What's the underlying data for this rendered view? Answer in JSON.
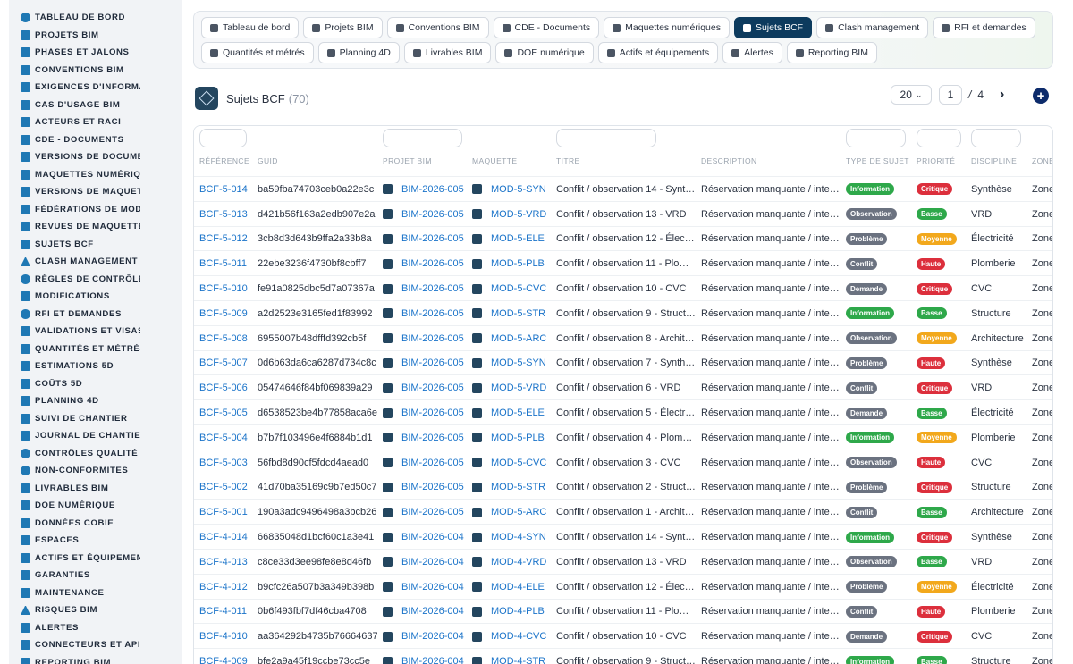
{
  "sidebar": {
    "items": [
      {
        "label": "TABLEAU DE BORD",
        "icon": "dashboard-icon"
      },
      {
        "label": "PROJETS BIM",
        "icon": "project-tree-icon"
      },
      {
        "label": "PHASES ET JALONS",
        "icon": "layers-icon"
      },
      {
        "label": "CONVENTIONS BIM",
        "icon": "book-icon"
      },
      {
        "label": "EXIGENCES D'INFORMATI",
        "icon": "file-icon"
      },
      {
        "label": "CAS D'USAGE BIM",
        "icon": "briefcase-icon"
      },
      {
        "label": "ACTEURS ET RACI",
        "icon": "users-icon"
      },
      {
        "label": "CDE - DOCUMENTS",
        "icon": "folder-icon"
      },
      {
        "label": "VERSIONS DE DOCUMEN",
        "icon": "branch-icon"
      },
      {
        "label": "MAQUETTES NUMÉRIQU",
        "icon": "cubes-icon"
      },
      {
        "label": "VERSIONS DE MAQUETT",
        "icon": "branch-icon"
      },
      {
        "label": "FÉDÉRATIONS DE MODÈ",
        "icon": "network-icon"
      },
      {
        "label": "REVUES DE MAQUETTES",
        "icon": "search-icon"
      },
      {
        "label": "SUJETS BCF",
        "icon": "comments-icon"
      },
      {
        "label": "CLASH MANAGEMENT",
        "icon": "warning-icon"
      },
      {
        "label": "RÈGLES DE CONTRÔLE",
        "icon": "gears-icon"
      },
      {
        "label": "MODIFICATIONS",
        "icon": "edit-icon"
      },
      {
        "label": "RFI ET DEMANDES",
        "icon": "question-icon"
      },
      {
        "label": "VALIDATIONS ET VISAS",
        "icon": "check-icon"
      },
      {
        "label": "QUANTITÉS ET MÉTRÉS",
        "icon": "calculator-icon"
      },
      {
        "label": "ESTIMATIONS 5D",
        "icon": "money-icon"
      },
      {
        "label": "COÛTS 5D",
        "icon": "coins-icon"
      },
      {
        "label": "PLANNING 4D",
        "icon": "calendar-icon"
      },
      {
        "label": "SUIVI DE CHANTIER",
        "icon": "helmet-icon"
      },
      {
        "label": "JOURNAL DE CHANTIER",
        "icon": "journal-icon"
      },
      {
        "label": "CONTRÔLES QUALITÉ",
        "icon": "check-circle-icon"
      },
      {
        "label": "NON-CONFORMITÉS",
        "icon": "alert-circle-icon"
      },
      {
        "label": "LIVRABLES BIM",
        "icon": "box-icon"
      },
      {
        "label": "DOE NUMÉRIQUE",
        "icon": "book-open-icon"
      },
      {
        "label": "DONNÉES COBIE",
        "icon": "table-icon"
      },
      {
        "label": "ESPACES",
        "icon": "door-icon"
      },
      {
        "label": "ACTIFS ET ÉQUIPEMENT",
        "icon": "tools-icon"
      },
      {
        "label": "GARANTIES",
        "icon": "shield-icon"
      },
      {
        "label": "MAINTENANCE",
        "icon": "wrench-icon"
      },
      {
        "label": "RISQUES BIM",
        "icon": "warning-icon"
      },
      {
        "label": "ALERTES",
        "icon": "bell-icon"
      },
      {
        "label": "CONNECTEURS ET API",
        "icon": "plug-icon"
      },
      {
        "label": "REPORTING BIM",
        "icon": "chart-icon"
      }
    ]
  },
  "tabs": {
    "row1": [
      {
        "label": "Tableau de bord",
        "active": false
      },
      {
        "label": "Projets BIM",
        "active": false
      },
      {
        "label": "Conventions BIM",
        "active": false
      },
      {
        "label": "CDE - Documents",
        "active": false
      },
      {
        "label": "Maquettes numériques",
        "active": false
      },
      {
        "label": "Sujets BCF",
        "active": true
      },
      {
        "label": "Clash management",
        "active": false
      },
      {
        "label": "RFI et demandes",
        "active": false
      }
    ],
    "row2": [
      {
        "label": "Quantités et métrés",
        "active": false
      },
      {
        "label": "Planning 4D",
        "active": false
      },
      {
        "label": "Livrables BIM",
        "active": false
      },
      {
        "label": "DOE numérique",
        "active": false
      },
      {
        "label": "Actifs et équipements",
        "active": false
      },
      {
        "label": "Alertes",
        "active": false
      },
      {
        "label": "Reporting BIM",
        "active": false
      }
    ]
  },
  "header": {
    "title": "Sujets BCF",
    "count": "(70)"
  },
  "pager": {
    "page_size": "20",
    "page": "1",
    "separator": "/",
    "total_pages": "4",
    "next": "›",
    "add": "+"
  },
  "table": {
    "columns": [
      "RÉFÉRENCE",
      "GUID",
      "PROJET BIM",
      "MAQUETTE",
      "TITRE",
      "DESCRIPTION",
      "TYPE DE SUJET",
      "PRIORITÉ",
      "DISCIPLINE",
      "ZONE"
    ],
    "rows": [
      {
        "ref": "BCF-5-014",
        "guid": "ba59fba74703ceb0a22e3c",
        "projet": "BIM-2026-005",
        "maquette": "MOD-5-SYN",
        "titre": "Conflit / observation 14 - Synt…",
        "desc": "Réservation manquante / inte…",
        "type": "Information",
        "prio": "Critique",
        "disc": "Synthèse",
        "zone": "Zone"
      },
      {
        "ref": "BCF-5-013",
        "guid": "d421b56f163a2edb907e2a",
        "projet": "BIM-2026-005",
        "maquette": "MOD-5-VRD",
        "titre": "Conflit / observation 13 - VRD",
        "desc": "Réservation manquante / inte…",
        "type": "Observation",
        "prio": "Basse",
        "disc": "VRD",
        "zone": "Zone"
      },
      {
        "ref": "BCF-5-012",
        "guid": "3cb8d3d643b9ffa2a33b8a",
        "projet": "BIM-2026-005",
        "maquette": "MOD-5-ELE",
        "titre": "Conflit / observation 12 - Élec…",
        "desc": "Réservation manquante / inte…",
        "type": "Problème",
        "prio": "Moyenne",
        "disc": "Électricité",
        "zone": "Zone"
      },
      {
        "ref": "BCF-5-011",
        "guid": "22ebe3236f4730bf8cbff7",
        "projet": "BIM-2026-005",
        "maquette": "MOD-5-PLB",
        "titre": "Conflit / observation 11 - Plo…",
        "desc": "Réservation manquante / inte…",
        "type": "Conflit",
        "prio": "Haute",
        "disc": "Plomberie",
        "zone": "Zone"
      },
      {
        "ref": "BCF-5-010",
        "guid": "fe91a0825dbc5d7a07367a",
        "projet": "BIM-2026-005",
        "maquette": "MOD-5-CVC",
        "titre": "Conflit / observation 10 - CVC",
        "desc": "Réservation manquante / inte…",
        "type": "Demande",
        "prio": "Critique",
        "disc": "CVC",
        "zone": "Zone"
      },
      {
        "ref": "BCF-5-009",
        "guid": "a2d2523e3165fed1f83992",
        "projet": "BIM-2026-005",
        "maquette": "MOD-5-STR",
        "titre": "Conflit / observation 9 - Struct…",
        "desc": "Réservation manquante / inte…",
        "type": "Information",
        "prio": "Basse",
        "disc": "Structure",
        "zone": "Zone"
      },
      {
        "ref": "BCF-5-008",
        "guid": "6955007b48dfffd392cb5f",
        "projet": "BIM-2026-005",
        "maquette": "MOD-5-ARC",
        "titre": "Conflit / observation 8 - Archit…",
        "desc": "Réservation manquante / inte…",
        "type": "Observation",
        "prio": "Moyenne",
        "disc": "Architecture",
        "zone": "Zone"
      },
      {
        "ref": "BCF-5-007",
        "guid": "0d6b63da6ca6287d734c8c",
        "projet": "BIM-2026-005",
        "maquette": "MOD-5-SYN",
        "titre": "Conflit / observation 7 - Synth…",
        "desc": "Réservation manquante / inte…",
        "type": "Problème",
        "prio": "Haute",
        "disc": "Synthèse",
        "zone": "Zone"
      },
      {
        "ref": "BCF-5-006",
        "guid": "05474646f84bf069839a29",
        "projet": "BIM-2026-005",
        "maquette": "MOD-5-VRD",
        "titre": "Conflit / observation 6 - VRD",
        "desc": "Réservation manquante / inte…",
        "type": "Conflit",
        "prio": "Critique",
        "disc": "VRD",
        "zone": "Zone"
      },
      {
        "ref": "BCF-5-005",
        "guid": "d6538523be4b77858aca6e",
        "projet": "BIM-2026-005",
        "maquette": "MOD-5-ELE",
        "titre": "Conflit / observation 5 - Électr…",
        "desc": "Réservation manquante / inte…",
        "type": "Demande",
        "prio": "Basse",
        "disc": "Électricité",
        "zone": "Zone"
      },
      {
        "ref": "BCF-5-004",
        "guid": "b7b7f103496e4f6884b1d1",
        "projet": "BIM-2026-005",
        "maquette": "MOD-5-PLB",
        "titre": "Conflit / observation 4 - Plom…",
        "desc": "Réservation manquante / inte…",
        "type": "Information",
        "prio": "Moyenne",
        "disc": "Plomberie",
        "zone": "Zone"
      },
      {
        "ref": "BCF-5-003",
        "guid": "56fbd8d90cf5fdcd4aead0",
        "projet": "BIM-2026-005",
        "maquette": "MOD-5-CVC",
        "titre": "Conflit / observation 3 - CVC",
        "desc": "Réservation manquante / inte…",
        "type": "Observation",
        "prio": "Haute",
        "disc": "CVC",
        "zone": "Zone"
      },
      {
        "ref": "BCF-5-002",
        "guid": "41d70ba35169c9b7ed50c7",
        "projet": "BIM-2026-005",
        "maquette": "MOD-5-STR",
        "titre": "Conflit / observation 2 - Struct…",
        "desc": "Réservation manquante / inte…",
        "type": "Problème",
        "prio": "Critique",
        "disc": "Structure",
        "zone": "Zone"
      },
      {
        "ref": "BCF-5-001",
        "guid": "190a3adc9496498a3bcb26",
        "projet": "BIM-2026-005",
        "maquette": "MOD-5-ARC",
        "titre": "Conflit / observation 1 - Archit…",
        "desc": "Réservation manquante / inte…",
        "type": "Conflit",
        "prio": "Basse",
        "disc": "Architecture",
        "zone": "Zone"
      },
      {
        "ref": "BCF-4-014",
        "guid": "66835048d1bcf60c1a3e41",
        "projet": "BIM-2026-004",
        "maquette": "MOD-4-SYN",
        "titre": "Conflit / observation 14 - Synt…",
        "desc": "Réservation manquante / inte…",
        "type": "Information",
        "prio": "Critique",
        "disc": "Synthèse",
        "zone": "Zone"
      },
      {
        "ref": "BCF-4-013",
        "guid": "c8ce33d3ee98fe8e8d46fb",
        "projet": "BIM-2026-004",
        "maquette": "MOD-4-VRD",
        "titre": "Conflit / observation 13 - VRD",
        "desc": "Réservation manquante / inte…",
        "type": "Observation",
        "prio": "Basse",
        "disc": "VRD",
        "zone": "Zone"
      },
      {
        "ref": "BCF-4-012",
        "guid": "b9cfc26a507b3a349b398b",
        "projet": "BIM-2026-004",
        "maquette": "MOD-4-ELE",
        "titre": "Conflit / observation 12 - Élec…",
        "desc": "Réservation manquante / inte…",
        "type": "Problème",
        "prio": "Moyenne",
        "disc": "Électricité",
        "zone": "Zone"
      },
      {
        "ref": "BCF-4-011",
        "guid": "0b6f493fbf7df46cba4708",
        "projet": "BIM-2026-004",
        "maquette": "MOD-4-PLB",
        "titre": "Conflit / observation 11 - Plo…",
        "desc": "Réservation manquante / inte…",
        "type": "Conflit",
        "prio": "Haute",
        "disc": "Plomberie",
        "zone": "Zone"
      },
      {
        "ref": "BCF-4-010",
        "guid": "aa364292b4735b76664637",
        "projet": "BIM-2026-004",
        "maquette": "MOD-4-CVC",
        "titre": "Conflit / observation 10 - CVC",
        "desc": "Réservation manquante / inte…",
        "type": "Demande",
        "prio": "Critique",
        "disc": "CVC",
        "zone": "Zone"
      },
      {
        "ref": "BCF-4-009",
        "guid": "bfe2a9a45f19ccbe73cc5e",
        "projet": "BIM-2026-004",
        "maquette": "MOD-4-STR",
        "titre": "Conflit / observation 9 - Struct…",
        "desc": "Réservation manquante / inte…",
        "type": "Information",
        "prio": "Basse",
        "disc": "Structure",
        "zone": "Zone"
      }
    ]
  },
  "colors": {
    "accent": "#1a73c9",
    "active_tab": "#0d3b5e",
    "type": {
      "Information": "#2ea84a",
      "Observation": "#6b7280",
      "Problème": "#6b7280",
      "Conflit": "#6b7280",
      "Demande": "#6b7280"
    },
    "prio": {
      "Critique": "#dc2f3c",
      "Basse": "#2ea84a",
      "Moyenne": "#f2a81c",
      "Haute": "#dc2f3c"
    }
  }
}
